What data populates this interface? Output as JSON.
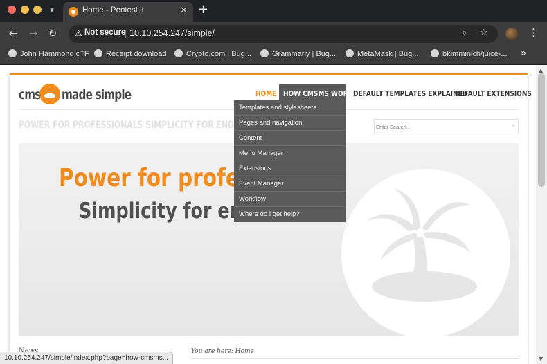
{
  "browser": {
    "tab": {
      "title": "Home - Pentest it"
    },
    "address_bar": {
      "security_label": "Not secure",
      "url": "10.10.254.247/simple/"
    },
    "bookmarks": [
      {
        "label": "John Hammond cTF",
        "icon": "github-icon"
      },
      {
        "label": "Receipt download",
        "icon": "globe-icon"
      },
      {
        "label": "Crypto.com | Bug...",
        "icon": "globe-icon"
      },
      {
        "label": "Grammarly | Bug...",
        "icon": "globe-icon"
      },
      {
        "label": "MetaMask | Bug...",
        "icon": "globe-icon"
      },
      {
        "label": "bkimminich/juice-...",
        "icon": "github-icon"
      }
    ],
    "status_url": "10.10.254.247/simple/index.php?page=how-cmsms..."
  },
  "site": {
    "logo_text": {
      "left": "cms",
      "right": "made simple"
    },
    "nav": [
      {
        "label": "HOME",
        "active": true
      },
      {
        "label": "HOW CMSMS WORKS",
        "hovered": true
      },
      {
        "label": "DEFAULT TEMPLATES EXPLAINED"
      },
      {
        "label": "DEFAULT EXTENSIONS"
      }
    ],
    "dropdown": [
      "Templates and stylesheets",
      "Pages and navigation",
      "Content",
      "Menu Manager",
      "Extensions",
      "Event Manager",
      "Workflow",
      "Where do i get help?"
    ],
    "tagline": "POWER FOR PROFESSIONALS SIMPLICITY FOR END",
    "search": {
      "placeholder": "Enter Search..."
    },
    "hero": {
      "line1": "Power for professi",
      "line2": "Simplicity for end"
    },
    "news_label": "News",
    "breadcrumb": "You are here: Home"
  },
  "colors": {
    "accent": "#f08b1d",
    "nav_hover": "#5a5a5a",
    "chrome_dark": "#202124",
    "chrome_toolbar": "#3c3c3c"
  }
}
